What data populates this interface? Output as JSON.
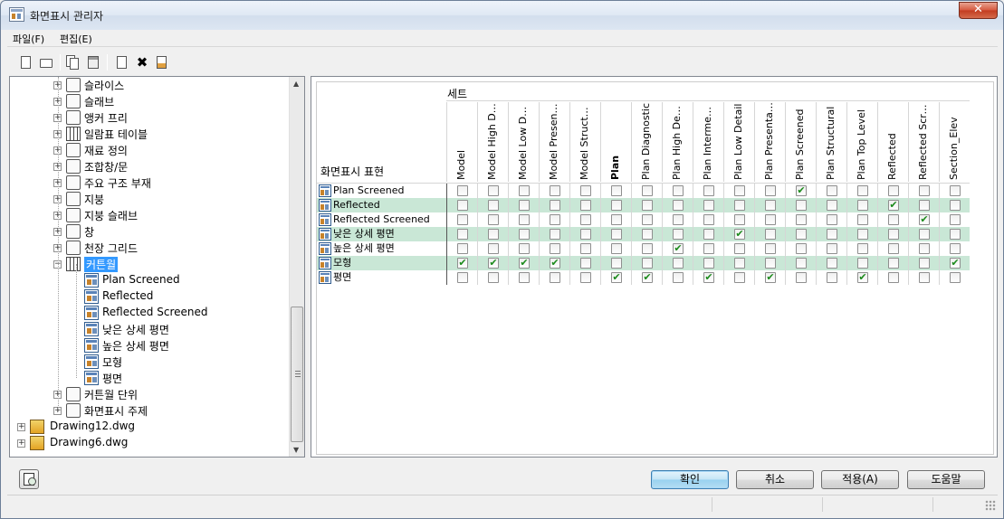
{
  "window": {
    "title": "화면표시 관리자",
    "close_label": "✕"
  },
  "menu": {
    "file": "파일(F)",
    "edit": "편집(E)"
  },
  "toolbar": {
    "new": "new-icon",
    "open": "open-icon",
    "copy": "copy-icon",
    "paste": "paste-icon",
    "properties": "properties-icon",
    "delete": "✖",
    "purge": "purge-icon"
  },
  "tree": {
    "items": [
      {
        "label": "슬라이스",
        "expand": "+"
      },
      {
        "label": "슬래브",
        "expand": "+"
      },
      {
        "label": "앵커 프리",
        "expand": "+"
      },
      {
        "label": "일람표 테이블",
        "expand": "+"
      },
      {
        "label": "재료 정의",
        "expand": "+"
      },
      {
        "label": "조합창/문",
        "expand": "+"
      },
      {
        "label": "주요 구조 부재",
        "expand": "+"
      },
      {
        "label": "지붕",
        "expand": "+"
      },
      {
        "label": "지붕 슬래브",
        "expand": "+"
      },
      {
        "label": "창",
        "expand": "+"
      },
      {
        "label": "천장 그리드",
        "expand": "+"
      },
      {
        "label": "커튼월",
        "expand": "−"
      },
      {
        "label": "Plan Screened"
      },
      {
        "label": "Reflected"
      },
      {
        "label": "Reflected Screened"
      },
      {
        "label": "낮은 상세 평면"
      },
      {
        "label": "높은 상세 평면"
      },
      {
        "label": "모형"
      },
      {
        "label": "평면"
      },
      {
        "label": "커튼월 단위",
        "expand": "+"
      },
      {
        "label": "화면표시 주제",
        "expand": "+"
      },
      {
        "label": "Drawing12.dwg",
        "expand": "+"
      },
      {
        "label": "Drawing6.dwg",
        "expand": "+"
      }
    ]
  },
  "grid": {
    "set_header": "세트",
    "rep_header": "화면표시 표현",
    "columns": [
      "Model",
      "Model High Det...",
      "Model Low Detail",
      "Model Presenta...",
      "Model Structural",
      "Plan",
      "Plan Diagnostic",
      "Plan High Detail",
      "Plan Intermedia...",
      "Plan Low Detail",
      "Plan Presentation",
      "Plan Screened",
      "Plan Structural",
      "Plan Top Level",
      "Reflected",
      "Reflected Scre...",
      "Section_Elev"
    ],
    "rows": [
      {
        "label": "Plan Screened",
        "checked": [
          11
        ]
      },
      {
        "label": "Reflected",
        "checked": [
          14
        ]
      },
      {
        "label": "Reflected Screened",
        "checked": [
          15
        ]
      },
      {
        "label": "낮은 상세 평면",
        "checked": [
          9
        ]
      },
      {
        "label": "높은 상세 평면",
        "checked": [
          7
        ]
      },
      {
        "label": "모형",
        "checked": [
          0,
          1,
          2,
          3,
          16
        ]
      },
      {
        "label": "평면",
        "checked": [
          5,
          6,
          8,
          10,
          13
        ]
      }
    ]
  },
  "buttons": {
    "ok": "확인",
    "cancel": "취소",
    "apply": "적용(A)",
    "help": "도움말"
  }
}
